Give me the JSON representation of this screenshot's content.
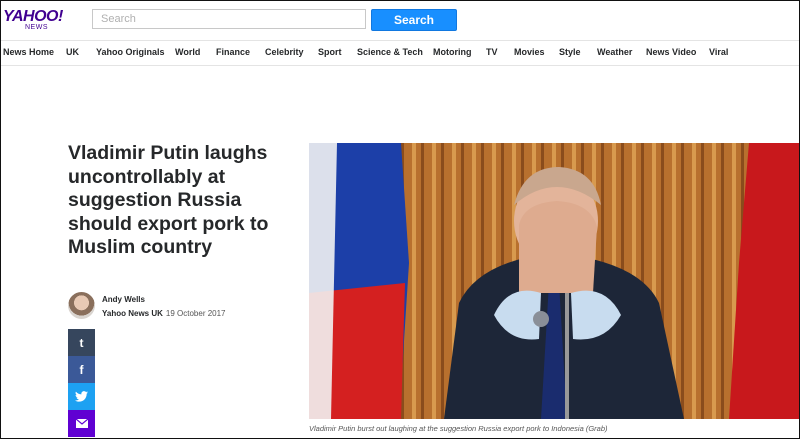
{
  "header": {
    "logo_main": "YAHOO!",
    "logo_sub": "NEWS",
    "search_placeholder": "Search",
    "search_button": "Search"
  },
  "nav": {
    "items": [
      "News Home",
      "UK",
      "Yahoo Originals",
      "World",
      "Finance",
      "Celebrity",
      "Sport",
      "Science & Tech",
      "Motoring",
      "TV",
      "Movies",
      "Style",
      "Weather",
      "News Video",
      "Viral"
    ]
  },
  "article": {
    "headline": "Vladimir Putin laughs uncontrollably at suggestion Russia should export pork to Muslim country",
    "author": "Andy Wells",
    "source": "Yahoo News UK",
    "date": "19 October 2017",
    "caption": "Vladimir Putin burst out laughing at the suggestion Russia export pork to Indonesia (Grab)"
  },
  "share": {
    "tumblr_glyph": "t",
    "facebook_glyph": "f",
    "icons": [
      "tumblr-icon",
      "facebook-icon",
      "twitter-icon",
      "mail-icon"
    ]
  },
  "colors": {
    "brand": "#400090",
    "search_button": "#188fff",
    "tumblr": "#36465d",
    "facebook": "#3b5998",
    "twitter": "#1da1f2",
    "mail": "#6001d2"
  }
}
